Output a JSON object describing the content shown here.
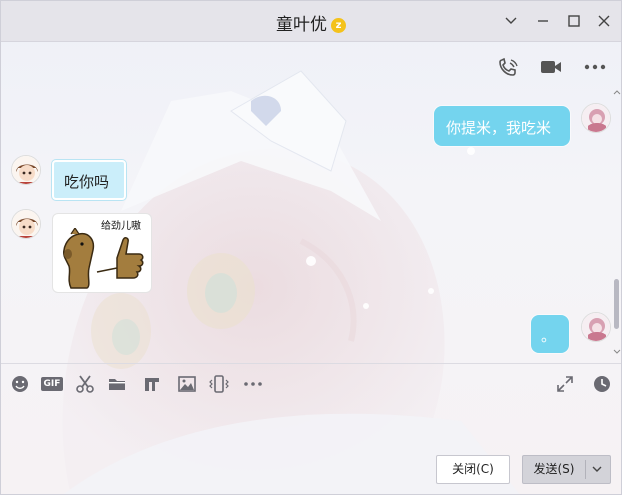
{
  "window": {
    "title": "童叶优",
    "vip_badge": "z"
  },
  "messages": [
    {
      "side": "right",
      "type": "text",
      "text": "你提米，我吃米"
    },
    {
      "side": "left",
      "type": "text",
      "text": "吃你吗"
    },
    {
      "side": "left",
      "type": "sticker",
      "caption": "给劲儿嗷",
      "icon": "horse-thumbs-up-icon"
    },
    {
      "side": "right",
      "type": "text",
      "text": "。"
    }
  ],
  "toolbar": {
    "icons": [
      "emoji-icon",
      "gif-icon",
      "scissors-icon",
      "folder-icon",
      "music-icon",
      "image-icon",
      "phone-shake-icon",
      "more-icon",
      "expand-icon",
      "history-clock-icon"
    ],
    "gif_label": "GIF"
  },
  "footer": {
    "close_label": "关闭(C)",
    "send_label": "发送(S)"
  },
  "colors": {
    "bubble_right": "#74d4ee",
    "bubble_left": "#cbeefa",
    "titlebar": "#e5e4ea"
  }
}
